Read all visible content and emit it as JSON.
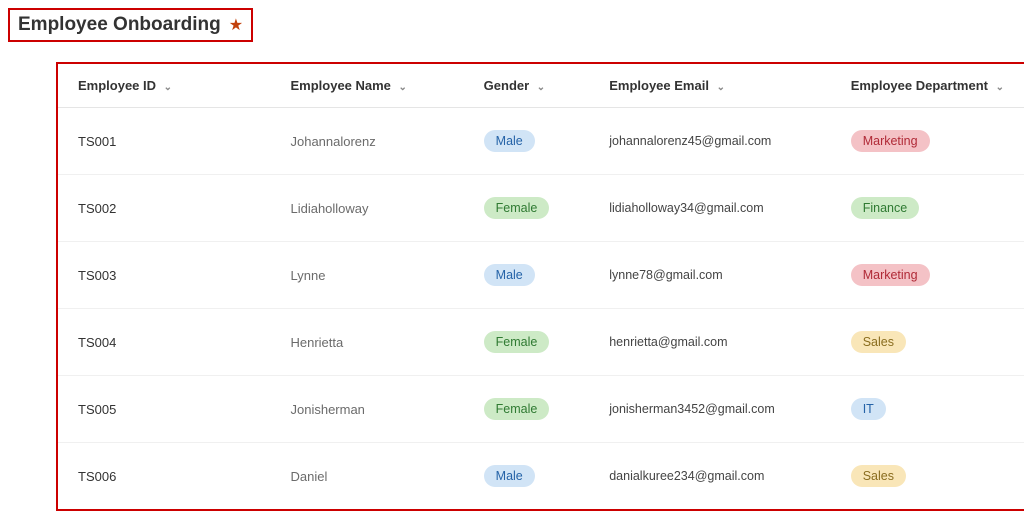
{
  "header": {
    "title": "Employee Onboarding",
    "star_icon": "★"
  },
  "table": {
    "columns": {
      "id": "Employee ID",
      "name": "Employee Name",
      "gender": "Gender",
      "email": "Employee Email",
      "department": "Employee Department"
    },
    "rows": [
      {
        "id": "TS001",
        "name": "Johannalorenz",
        "gender": "Male",
        "email": "johannalorenz45@gmail.com",
        "department": "Marketing"
      },
      {
        "id": "TS002",
        "name": "Lidiaholloway",
        "gender": "Female",
        "email": "lidiaholloway34@gmail.com",
        "department": "Finance"
      },
      {
        "id": "TS003",
        "name": "Lynne",
        "gender": "Male",
        "email": "lynne78@gmail.com",
        "department": "Marketing"
      },
      {
        "id": "TS004",
        "name": "Henrietta",
        "gender": "Female",
        "email": "henrietta@gmail.com",
        "department": "Sales"
      },
      {
        "id": "TS005",
        "name": "Jonisherman",
        "gender": "Female",
        "email": "jonisherman3452@gmail.com",
        "department": "IT"
      },
      {
        "id": "TS006",
        "name": "Daniel",
        "gender": "Male",
        "email": "danialkuree234@gmail.com",
        "department": "Sales"
      }
    ]
  },
  "pill_classes": {
    "gender": {
      "Male": "pill-male",
      "Female": "pill-female"
    },
    "department": {
      "Marketing": "pill-marketing",
      "Finance": "pill-finance",
      "Sales": "pill-sales",
      "IT": "pill-it"
    }
  }
}
